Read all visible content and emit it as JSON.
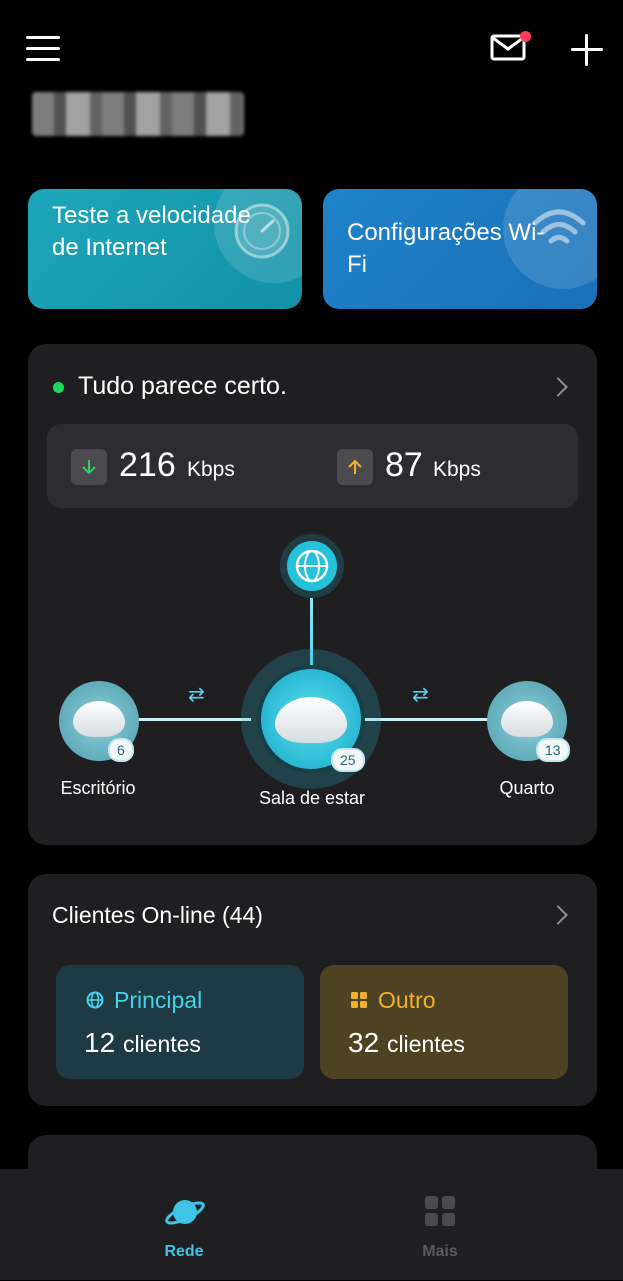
{
  "header": {
    "menu_icon": "hamburger-menu-icon",
    "mail_icon": "mail-icon",
    "add_icon": "plus-icon"
  },
  "quick_actions": {
    "speed_test_label": "Teste a velocidade de Internet",
    "wifi_settings_label": "Configurações Wi-Fi"
  },
  "status": {
    "text": "Tudo parece certo.",
    "download_value": "216",
    "download_unit": "Kbps",
    "upload_value": "87",
    "upload_unit": "Kbps"
  },
  "topology": {
    "nodes": [
      {
        "label": "Escritório",
        "clients": "6"
      },
      {
        "label": "Sala de estar",
        "clients": "25"
      },
      {
        "label": "Quarto",
        "clients": "13"
      }
    ]
  },
  "clients": {
    "title": "Clientes On-line (44)",
    "principal_label": "Principal",
    "principal_count": "12",
    "principal_unit": "clientes",
    "outro_label": "Outro",
    "outro_count": "32",
    "outro_unit": "clientes"
  },
  "bottom_nav": {
    "items": [
      {
        "label": "Rede",
        "active": true
      },
      {
        "label": "Mais",
        "active": false
      }
    ]
  },
  "colors": {
    "accent": "#3fc3e6",
    "status_ok": "#1ed760",
    "principal": "#44d2ea",
    "outro": "#f0b12e"
  }
}
